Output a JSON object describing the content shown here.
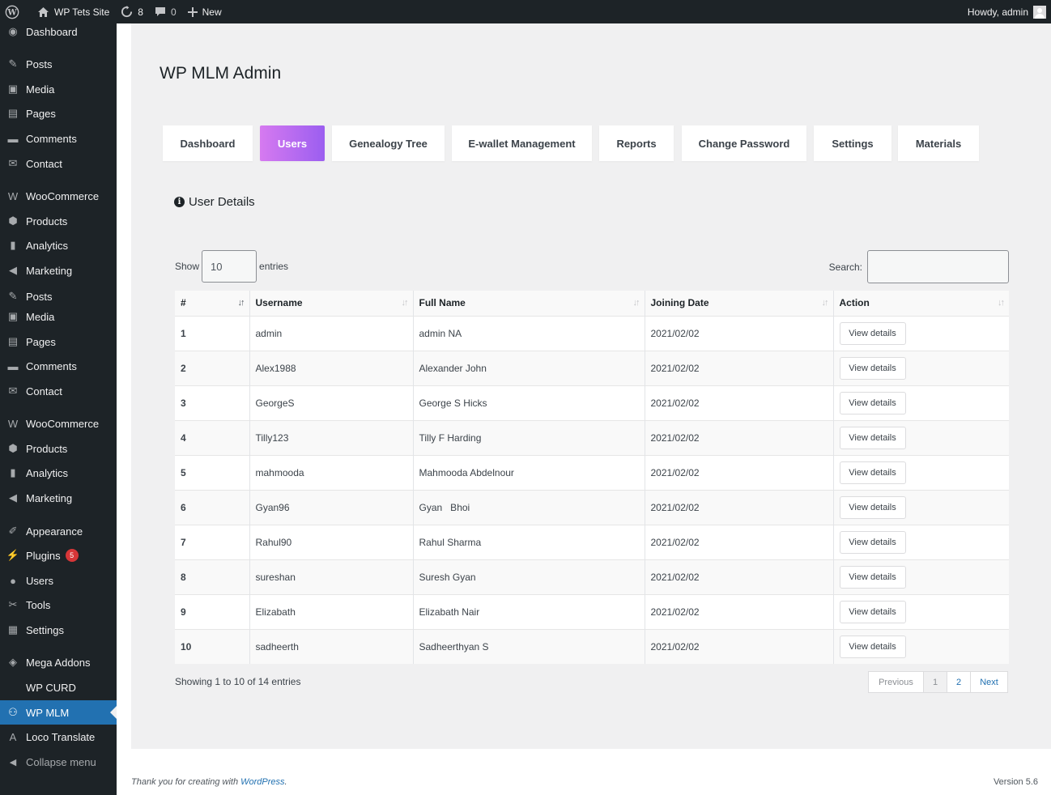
{
  "adminbar": {
    "site_name": "WP Tets Site",
    "updates_count": "8",
    "comments_count": "0",
    "new_label": "New",
    "greeting": "Howdy, admin"
  },
  "sidebar": {
    "items": [
      {
        "label": "Dashboard",
        "icon": "dashboard-icon"
      },
      {
        "label": "Posts",
        "icon": "pin-icon"
      },
      {
        "label": "Media",
        "icon": "media-icon"
      },
      {
        "label": "Pages",
        "icon": "pages-icon"
      },
      {
        "label": "Comments",
        "icon": "comment-icon"
      },
      {
        "label": "Contact",
        "icon": "mail-icon"
      },
      {
        "label": "WooCommerce",
        "icon": "woo-icon"
      },
      {
        "label": "Products",
        "icon": "box-icon"
      },
      {
        "label": "Analytics",
        "icon": "bar-chart-icon"
      },
      {
        "label": "Marketing",
        "icon": "megaphone-icon"
      },
      {
        "label": "Posts",
        "icon": "pin-icon"
      },
      {
        "label": "Media",
        "icon": "media-icon"
      },
      {
        "label": "Pages",
        "icon": "pages-icon"
      },
      {
        "label": "Comments",
        "icon": "comment-icon"
      },
      {
        "label": "Contact",
        "icon": "mail-icon"
      },
      {
        "label": "WooCommerce",
        "icon": "woo-icon"
      },
      {
        "label": "Products",
        "icon": "box-icon"
      },
      {
        "label": "Analytics",
        "icon": "bar-chart-icon"
      },
      {
        "label": "Marketing",
        "icon": "megaphone-icon"
      },
      {
        "label": "Appearance",
        "icon": "brush-icon"
      },
      {
        "label": "Plugins",
        "icon": "plug-icon",
        "badge": "5"
      },
      {
        "label": "Users",
        "icon": "user-icon"
      },
      {
        "label": "Tools",
        "icon": "wrench-icon"
      },
      {
        "label": "Settings",
        "icon": "settings-icon"
      },
      {
        "label": "Mega Addons",
        "icon": "shield-icon"
      },
      {
        "label": "WP CURD",
        "icon": ""
      },
      {
        "label": "WP MLM",
        "icon": "network-icon"
      },
      {
        "label": "Loco Translate",
        "icon": "translate-icon"
      },
      {
        "label": "Collapse menu",
        "icon": "collapse-icon"
      }
    ]
  },
  "page": {
    "title": "WP MLM Admin",
    "tabs": [
      "Dashboard",
      "Users",
      "Genealogy Tree",
      "E-wallet Management",
      "Reports",
      "Change Password",
      "Settings",
      "Materials"
    ],
    "active_tab": "Users",
    "section_title": "User Details"
  },
  "table_controls": {
    "show_label": "Show",
    "entries_value": "10",
    "entries_label": "entries",
    "search_label": "Search:"
  },
  "table": {
    "headers": [
      "#",
      "Username",
      "Full Name",
      "Joining Date",
      "Action"
    ],
    "rows": [
      {
        "num": "1",
        "username": "admin",
        "fullname": "admin NA",
        "date": "2021/02/02",
        "action": "View details"
      },
      {
        "num": "2",
        "username": "Alex1988",
        "fullname": "Alexander John",
        "date": "2021/02/02",
        "action": "View details"
      },
      {
        "num": "3",
        "username": "GeorgeS",
        "fullname": "George S Hicks",
        "date": "2021/02/02",
        "action": "View details"
      },
      {
        "num": "4",
        "username": "Tilly123",
        "fullname": "Tilly F Harding",
        "date": "2021/02/02",
        "action": "View details"
      },
      {
        "num": "5",
        "username": "mahmooda",
        "fullname": "Mahmooda Abdelnour",
        "date": "2021/02/02",
        "action": "View details"
      },
      {
        "num": "6",
        "username": "Gyan96",
        "fullname": "Gyan   Bhoi",
        "date": "2021/02/02",
        "action": "View details"
      },
      {
        "num": "7",
        "username": "Rahul90",
        "fullname": "Rahul Sharma",
        "date": "2021/02/02",
        "action": "View details"
      },
      {
        "num": "8",
        "username": "sureshan",
        "fullname": "Suresh Gyan",
        "date": "2021/02/02",
        "action": "View details"
      },
      {
        "num": "9",
        "username": "Elizabath",
        "fullname": "Elizabath Nair",
        "date": "2021/02/02",
        "action": "View details"
      },
      {
        "num": "10",
        "username": "sadheerth",
        "fullname": "Sadheerthyan S",
        "date": "2021/02/02",
        "action": "View details"
      }
    ],
    "info": "Showing 1 to 10 of 14 entries"
  },
  "pagination": {
    "previous": "Previous",
    "pages": [
      "1",
      "2"
    ],
    "next": "Next"
  },
  "footer": {
    "text": "Thank you for creating with ",
    "link": "WordPress",
    "suffix": ".",
    "version": "Version 5.6"
  },
  "colors": {
    "admin_dark": "#1d2327",
    "accent_blue": "#2271b1",
    "tab_gradient_start": "#d67af0",
    "tab_gradient_end": "#9b5ef0",
    "badge_red": "#d63638"
  }
}
